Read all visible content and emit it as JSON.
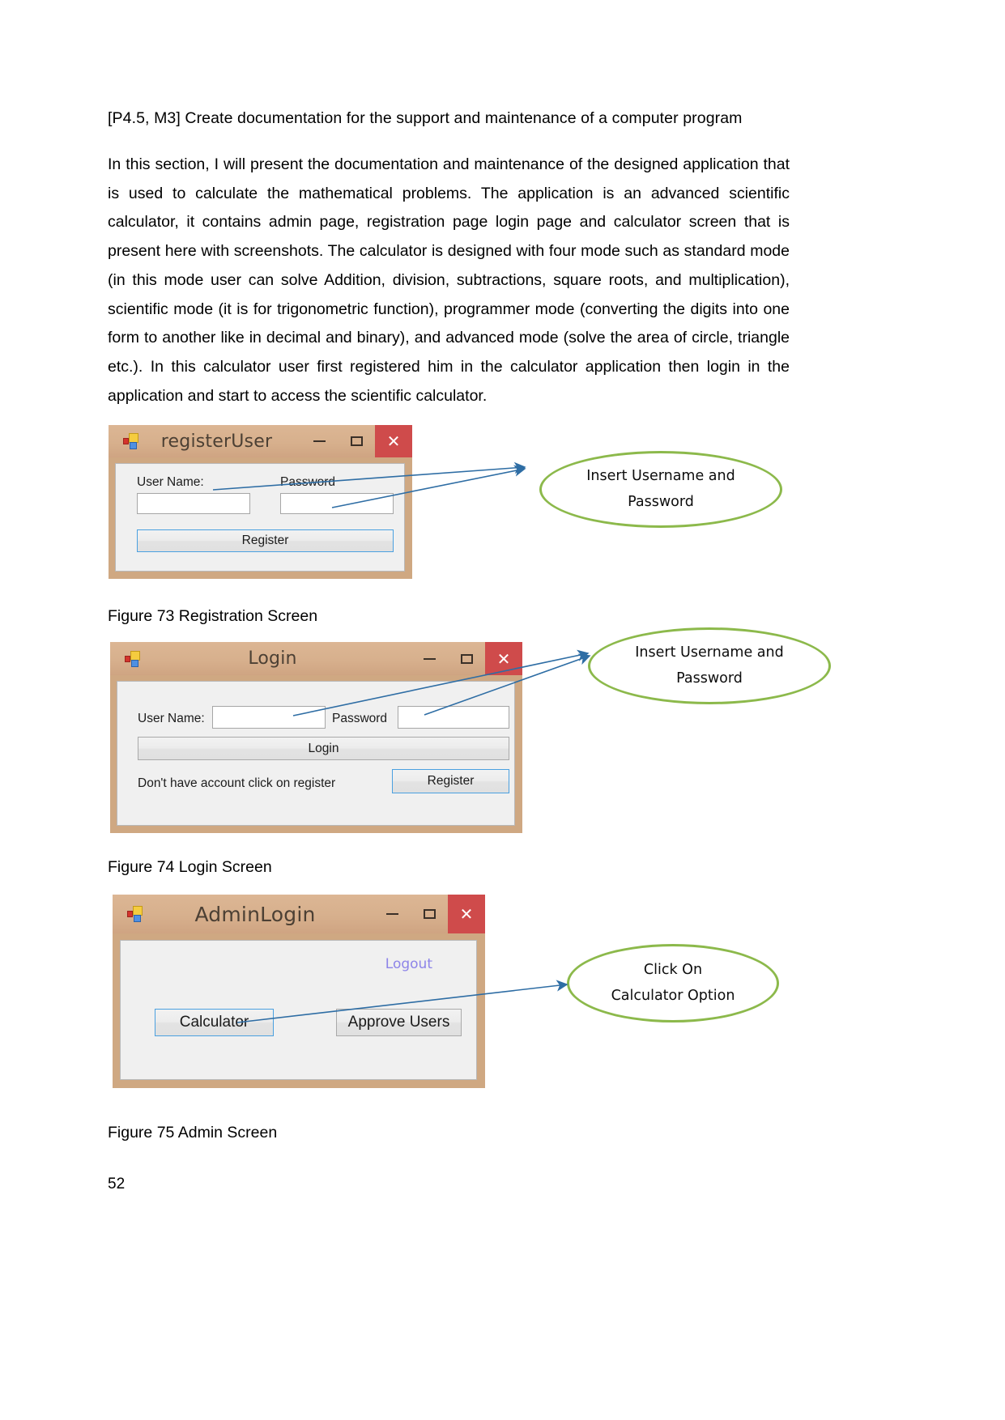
{
  "document": {
    "heading": "[P4.5, M3] Create documentation for the support and maintenance of a computer program",
    "paragraph": "In this section, I will present the documentation and maintenance of the designed application that is used to calculate the mathematical problems. The application is an advanced scientific calculator, it contains admin page, registration page login page and calculator screen that is present here with screenshots. The calculator is designed with four mode such as standard mode (in this mode user can solve Addition, division, subtractions, square roots, and multiplication), scientific mode (it is for trigonometric function), programmer mode (converting the digits into one form to another like in decimal and binary), and advanced mode (solve the area of circle, triangle etc.). In this calculator user first registered him in the calculator application then login in the application and start to access the scientific calculator.",
    "page_number": "52",
    "captions": {
      "figure_73": "Figure 73 Registration Screen",
      "figure_74": "Figure 74 Login Screen",
      "figure_75": "Figure 75 Admin Screen"
    }
  },
  "colors": {
    "window_frame": "#cfa882",
    "titlebar": "#d8b190",
    "close_button": "#cf4b4b",
    "callout_outline": "#8cb94b",
    "arrow": "#2e6da4",
    "focus_border": "#4aa0e0",
    "link_text": "#8d84e8"
  },
  "windows": {
    "register": {
      "title": "registerUser",
      "icon": "winforms-app-icon",
      "minimize": "minimize-icon",
      "maximize": "maximize-icon",
      "close": "✕",
      "username_label": "User Name:",
      "password_label": "Password",
      "username_value": "",
      "password_value": "",
      "register_button": "Register"
    },
    "login": {
      "title": "Login",
      "icon": "winforms-app-icon",
      "minimize": "minimize-icon",
      "maximize": "maximize-icon",
      "close": "✕",
      "username_label": "User Name:",
      "password_label": "Password",
      "username_value": "",
      "password_value": "",
      "login_button": "Login",
      "hint_text": "Don't have account click on register",
      "register_button": "Register"
    },
    "admin": {
      "title": "AdminLogin",
      "icon": "winforms-app-icon",
      "minimize": "minimize-icon",
      "maximize": "maximize-icon",
      "close": "✕",
      "logout_link": "Logout",
      "calculator_button": "Calculator",
      "approve_users_button": "Approve Users"
    }
  },
  "callouts": {
    "register": {
      "line1": "Insert Username and",
      "line2": "Password"
    },
    "login": {
      "line1": "Insert Username and",
      "line2": "Password"
    },
    "admin": {
      "line1": "Click On",
      "line2": "Calculator Option"
    }
  }
}
